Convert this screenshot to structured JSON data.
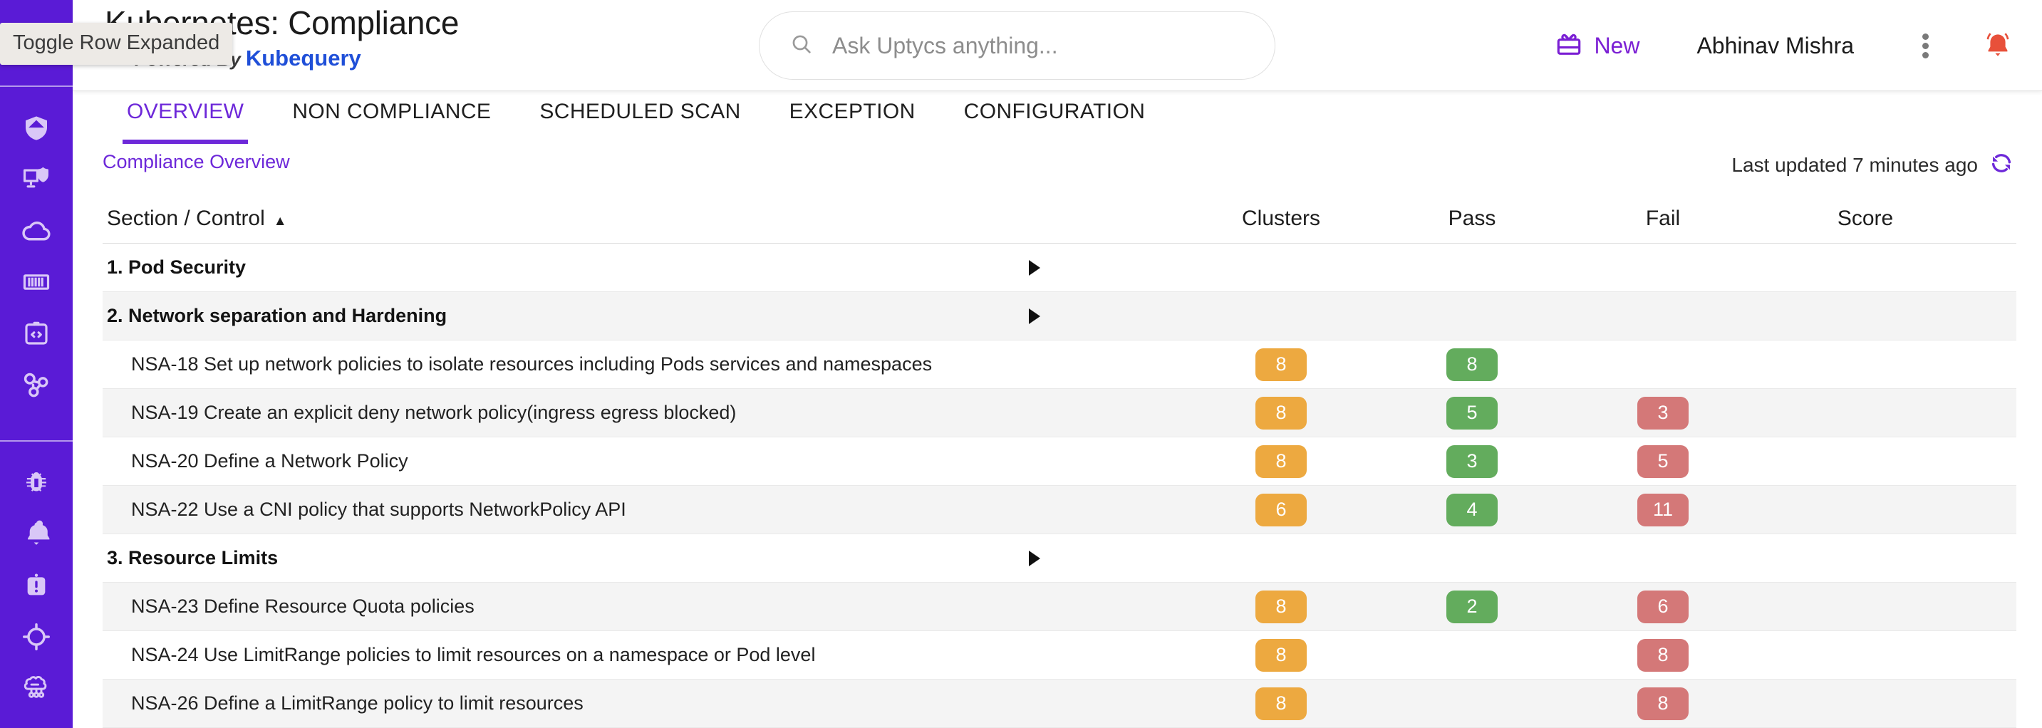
{
  "tooltip": {
    "text": "Toggle Row Expanded"
  },
  "header": {
    "title": "Kubernetes: Compliance",
    "powered_prefix": "Powered By",
    "powered_brand": "Kubequery",
    "search": {
      "placeholder": "Ask Uptycs anything...",
      "value": "",
      "icon": "search-icon"
    },
    "new_label": "New",
    "new_icon": "gift-icon",
    "user_name": "Abhinav Mishra",
    "kebab_icon": "more-vertical-icon",
    "bell_icon": "notification-bell-icon",
    "accent": "#6d28d9",
    "bell_color": "#E8503A"
  },
  "sidebar": {
    "background": "#5A1BD6",
    "items": [
      {
        "name": "sidebar-item-shield",
        "icon": "shield-icon"
      },
      {
        "name": "sidebar-item-endpoint",
        "icon": "monitor-shield-icon"
      },
      {
        "name": "sidebar-item-cloud",
        "icon": "cloud-icon"
      },
      {
        "name": "sidebar-item-containers",
        "icon": "container-icon"
      },
      {
        "name": "sidebar-item-code",
        "icon": "clipboard-code-icon"
      },
      {
        "name": "sidebar-item-kubernetes",
        "icon": "kubernetes-nodes-icon"
      },
      {
        "name": "sidebar-item-threats",
        "icon": "bug-icon"
      },
      {
        "name": "sidebar-item-alerts",
        "icon": "bell-icon"
      },
      {
        "name": "sidebar-item-incidents",
        "icon": "alert-clipboard-icon"
      },
      {
        "name": "sidebar-item-detections",
        "icon": "target-icon"
      },
      {
        "name": "sidebar-item-ai",
        "icon": "brain-circuit-icon"
      }
    ]
  },
  "tabs": [
    {
      "label": "OVERVIEW",
      "active": true
    },
    {
      "label": "NON COMPLIANCE",
      "active": false
    },
    {
      "label": "SCHEDULED SCAN",
      "active": false
    },
    {
      "label": "EXCEPTION",
      "active": false
    },
    {
      "label": "CONFIGURATION",
      "active": false
    }
  ],
  "breadcrumb": "Compliance Overview",
  "last_updated": {
    "text": "Last updated 7 minutes ago",
    "icon": "refresh-icon",
    "color": "#6d28d9"
  },
  "table": {
    "columns": [
      "Section / Control",
      "Clusters",
      "Pass",
      "Fail",
      "Score"
    ],
    "sort_column": "Section / Control",
    "sort_direction": "asc",
    "sort_glyph": "▲",
    "rows": [
      {
        "type": "section",
        "label": "1. Pod Security",
        "expandable": true,
        "clusters": "",
        "pass": "",
        "fail": "",
        "score": ""
      },
      {
        "type": "section",
        "label": "2. Network separation and Hardening",
        "expandable": true,
        "clusters": "",
        "pass": "",
        "fail": "",
        "score": ""
      },
      {
        "type": "control",
        "label": "NSA-18 Set up network policies to isolate resources including Pods services and namespaces",
        "clusters": "8",
        "pass": "8",
        "fail": "",
        "score": ""
      },
      {
        "type": "control",
        "label": "NSA-19 Create an explicit deny network policy(ingress egress blocked)",
        "clusters": "8",
        "pass": "5",
        "fail": "3",
        "score": ""
      },
      {
        "type": "control",
        "label": "NSA-20 Define a Network Policy",
        "clusters": "8",
        "pass": "3",
        "fail": "5",
        "score": ""
      },
      {
        "type": "control",
        "label": "NSA-22 Use a CNI policy that supports NetworkPolicy API",
        "clusters": "6",
        "pass": "4",
        "fail": "11",
        "score": ""
      },
      {
        "type": "section",
        "label": "3. Resource Limits",
        "expandable": true,
        "clusters": "",
        "pass": "",
        "fail": "",
        "score": ""
      },
      {
        "type": "control",
        "label": "NSA-23 Define Resource Quota policies",
        "clusters": "8",
        "pass": "2",
        "fail": "6",
        "score": ""
      },
      {
        "type": "control",
        "label": "NSA-24 Use LimitRange policies to limit resources on a namespace or Pod level",
        "clusters": "8",
        "pass": "",
        "fail": "8",
        "score": ""
      },
      {
        "type": "control",
        "label": "NSA-26 Define a LimitRange policy to limit resources",
        "clusters": "8",
        "pass": "",
        "fail": "8",
        "score": ""
      }
    ],
    "badge_colors": {
      "clusters": "#EDA940",
      "pass": "#63AC5D",
      "fail": "#D47878"
    }
  }
}
